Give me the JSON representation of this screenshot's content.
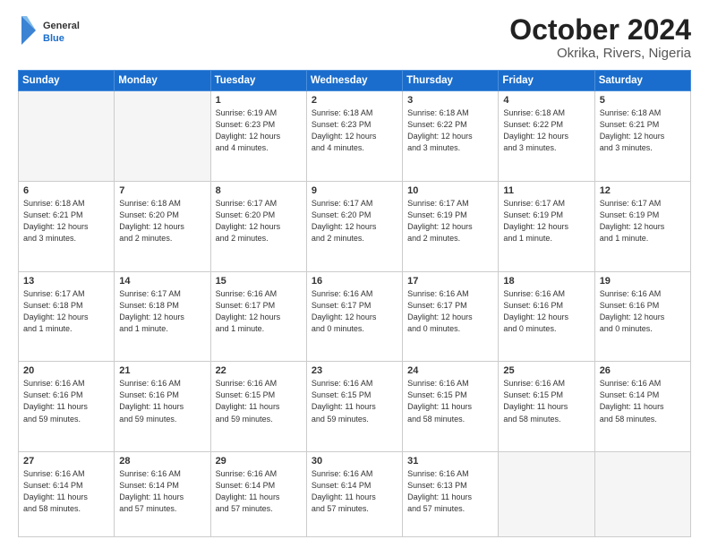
{
  "logo": {
    "general": "General",
    "blue": "Blue"
  },
  "header": {
    "title": "October 2024",
    "subtitle": "Okrika, Rivers, Nigeria"
  },
  "weekdays": [
    "Sunday",
    "Monday",
    "Tuesday",
    "Wednesday",
    "Thursday",
    "Friday",
    "Saturday"
  ],
  "weeks": [
    [
      {
        "day": "",
        "info": ""
      },
      {
        "day": "",
        "info": ""
      },
      {
        "day": "1",
        "info": "Sunrise: 6:19 AM\nSunset: 6:23 PM\nDaylight: 12 hours\nand 4 minutes."
      },
      {
        "day": "2",
        "info": "Sunrise: 6:18 AM\nSunset: 6:23 PM\nDaylight: 12 hours\nand 4 minutes."
      },
      {
        "day": "3",
        "info": "Sunrise: 6:18 AM\nSunset: 6:22 PM\nDaylight: 12 hours\nand 3 minutes."
      },
      {
        "day": "4",
        "info": "Sunrise: 6:18 AM\nSunset: 6:22 PM\nDaylight: 12 hours\nand 3 minutes."
      },
      {
        "day": "5",
        "info": "Sunrise: 6:18 AM\nSunset: 6:21 PM\nDaylight: 12 hours\nand 3 minutes."
      }
    ],
    [
      {
        "day": "6",
        "info": "Sunrise: 6:18 AM\nSunset: 6:21 PM\nDaylight: 12 hours\nand 3 minutes."
      },
      {
        "day": "7",
        "info": "Sunrise: 6:18 AM\nSunset: 6:20 PM\nDaylight: 12 hours\nand 2 minutes."
      },
      {
        "day": "8",
        "info": "Sunrise: 6:17 AM\nSunset: 6:20 PM\nDaylight: 12 hours\nand 2 minutes."
      },
      {
        "day": "9",
        "info": "Sunrise: 6:17 AM\nSunset: 6:20 PM\nDaylight: 12 hours\nand 2 minutes."
      },
      {
        "day": "10",
        "info": "Sunrise: 6:17 AM\nSunset: 6:19 PM\nDaylight: 12 hours\nand 2 minutes."
      },
      {
        "day": "11",
        "info": "Sunrise: 6:17 AM\nSunset: 6:19 PM\nDaylight: 12 hours\nand 1 minute."
      },
      {
        "day": "12",
        "info": "Sunrise: 6:17 AM\nSunset: 6:19 PM\nDaylight: 12 hours\nand 1 minute."
      }
    ],
    [
      {
        "day": "13",
        "info": "Sunrise: 6:17 AM\nSunset: 6:18 PM\nDaylight: 12 hours\nand 1 minute."
      },
      {
        "day": "14",
        "info": "Sunrise: 6:17 AM\nSunset: 6:18 PM\nDaylight: 12 hours\nand 1 minute."
      },
      {
        "day": "15",
        "info": "Sunrise: 6:16 AM\nSunset: 6:17 PM\nDaylight: 12 hours\nand 1 minute."
      },
      {
        "day": "16",
        "info": "Sunrise: 6:16 AM\nSunset: 6:17 PM\nDaylight: 12 hours\nand 0 minutes."
      },
      {
        "day": "17",
        "info": "Sunrise: 6:16 AM\nSunset: 6:17 PM\nDaylight: 12 hours\nand 0 minutes."
      },
      {
        "day": "18",
        "info": "Sunrise: 6:16 AM\nSunset: 6:16 PM\nDaylight: 12 hours\nand 0 minutes."
      },
      {
        "day": "19",
        "info": "Sunrise: 6:16 AM\nSunset: 6:16 PM\nDaylight: 12 hours\nand 0 minutes."
      }
    ],
    [
      {
        "day": "20",
        "info": "Sunrise: 6:16 AM\nSunset: 6:16 PM\nDaylight: 11 hours\nand 59 minutes."
      },
      {
        "day": "21",
        "info": "Sunrise: 6:16 AM\nSunset: 6:16 PM\nDaylight: 11 hours\nand 59 minutes."
      },
      {
        "day": "22",
        "info": "Sunrise: 6:16 AM\nSunset: 6:15 PM\nDaylight: 11 hours\nand 59 minutes."
      },
      {
        "day": "23",
        "info": "Sunrise: 6:16 AM\nSunset: 6:15 PM\nDaylight: 11 hours\nand 59 minutes."
      },
      {
        "day": "24",
        "info": "Sunrise: 6:16 AM\nSunset: 6:15 PM\nDaylight: 11 hours\nand 58 minutes."
      },
      {
        "day": "25",
        "info": "Sunrise: 6:16 AM\nSunset: 6:15 PM\nDaylight: 11 hours\nand 58 minutes."
      },
      {
        "day": "26",
        "info": "Sunrise: 6:16 AM\nSunset: 6:14 PM\nDaylight: 11 hours\nand 58 minutes."
      }
    ],
    [
      {
        "day": "27",
        "info": "Sunrise: 6:16 AM\nSunset: 6:14 PM\nDaylight: 11 hours\nand 58 minutes."
      },
      {
        "day": "28",
        "info": "Sunrise: 6:16 AM\nSunset: 6:14 PM\nDaylight: 11 hours\nand 57 minutes."
      },
      {
        "day": "29",
        "info": "Sunrise: 6:16 AM\nSunset: 6:14 PM\nDaylight: 11 hours\nand 57 minutes."
      },
      {
        "day": "30",
        "info": "Sunrise: 6:16 AM\nSunset: 6:14 PM\nDaylight: 11 hours\nand 57 minutes."
      },
      {
        "day": "31",
        "info": "Sunrise: 6:16 AM\nSunset: 6:13 PM\nDaylight: 11 hours\nand 57 minutes."
      },
      {
        "day": "",
        "info": ""
      },
      {
        "day": "",
        "info": ""
      }
    ]
  ]
}
